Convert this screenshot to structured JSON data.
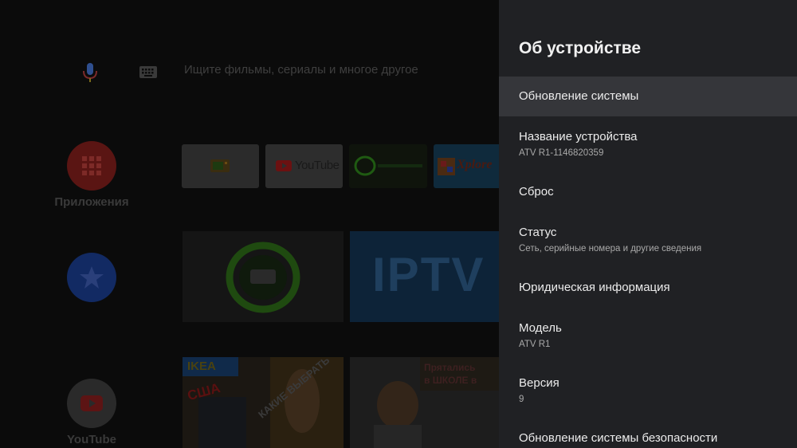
{
  "launcher": {
    "search_placeholder": "Ищите фильмы, сериалы и многое другое",
    "rail": [
      {
        "label": "Приложения"
      },
      {
        "label": ""
      },
      {
        "label": "YouTube"
      }
    ],
    "apps": [
      {
        "name": "",
        "icon": "tv-app-icon"
      },
      {
        "name": "YouTube",
        "icon": "youtube-logo"
      },
      {
        "name": "",
        "icon": "itv-logo"
      },
      {
        "name": "Xplore",
        "icon": "xplore-logo"
      }
    ],
    "cards": [
      {
        "title": ""
      },
      {
        "title": "IPTV"
      },
      {
        "overlay": [
          "IKEA",
          "США",
          "КАКИЕ ВЫБРАТЬ"
        ]
      },
      {
        "overlay": [
          "Прятались",
          "в ШКОЛЕ в"
        ]
      }
    ]
  },
  "panel": {
    "title": "Об устройстве",
    "items": [
      {
        "title": "Обновление системы",
        "subtitle": ""
      },
      {
        "title": "Название устройства",
        "subtitle": "ATV R1-1146820359"
      },
      {
        "title": "Сброс",
        "subtitle": ""
      },
      {
        "title": "Статус",
        "subtitle": "Сеть, серийные номера и другие сведения"
      },
      {
        "title": "Юридическая информация",
        "subtitle": ""
      },
      {
        "title": "Модель",
        "subtitle": "ATV R1"
      },
      {
        "title": "Версия",
        "subtitle": "9"
      },
      {
        "title": "Обновление системы безопасности",
        "subtitle": ""
      }
    ],
    "focused_index": 0
  },
  "colors": {
    "panel_bg": "#202124",
    "focused_bg": "#35363a",
    "apps_red": "#a8201c",
    "favorites_blue": "#1d3fa3",
    "itv_green": "#3fae1e",
    "iptv_blue": "#12385c"
  }
}
